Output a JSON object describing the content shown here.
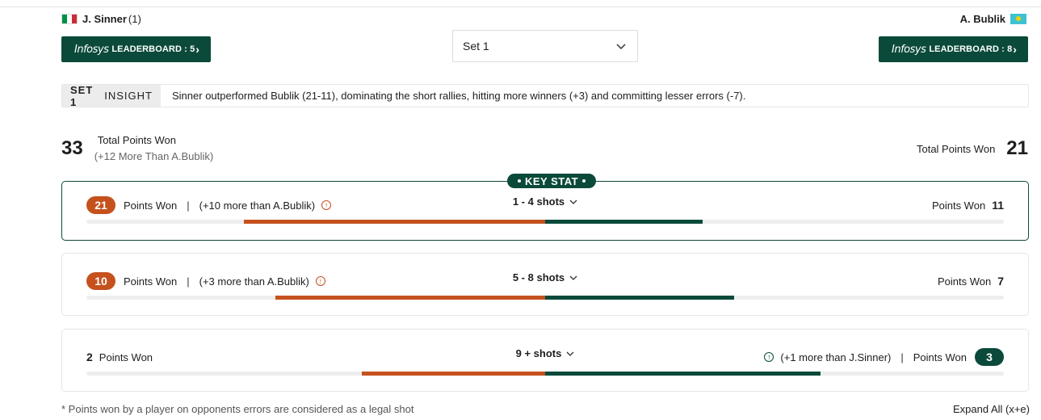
{
  "players": {
    "left": {
      "name": "J. Sinner",
      "seed": "(1)",
      "flag": "italy-flag"
    },
    "right": {
      "name": "A. Bublik",
      "flag": "kazakhstan-flag"
    }
  },
  "leaderboard": {
    "brand": "Infosys",
    "left_label": "LEADERBOARD : 5",
    "right_label": "LEADERBOARD : 8"
  },
  "set_select": {
    "value": "Set 1"
  },
  "insight": {
    "tag_bold": "SET 1",
    "tag": "INSIGHT",
    "text": "Sinner outperformed Bublik (21-11), dominating the short rallies, hitting more winners (+3) and committing lesser errors (-7)."
  },
  "totals": {
    "left_num": "33",
    "left_label": "Total Points Won",
    "left_sub": "(+12 More Than A.Bublik)",
    "right_label": "Total Points Won",
    "right_num": "21"
  },
  "key_stat": "KEY STAT",
  "cards": [
    {
      "left_num": "21",
      "left_label": "Points Won",
      "left_diff": "(+10 more than A.Bublik)",
      "shots": "1 - 4 shots",
      "right_label": "Points Won",
      "right_num": "11",
      "left_fraction": 0.656,
      "right_fraction": 0.344
    },
    {
      "left_num": "10",
      "left_label": "Points Won",
      "left_diff": "(+3 more than A.Bublik)",
      "shots": "5 - 8 shots",
      "right_label": "Points Won",
      "right_num": "7",
      "left_fraction": 0.588,
      "right_fraction": 0.412
    },
    {
      "left_num": "2",
      "left_label": "Points Won",
      "right_diff": "(+1 more than J.Sinner)",
      "shots": "9 + shots",
      "right_label": "Points Won",
      "right_num": "3",
      "left_fraction": 0.4,
      "right_fraction": 0.6
    }
  ],
  "footnote": "* Points won by a player on opponents errors are considered as a legal shot",
  "expand_all": "Expand All (x+e)",
  "colors": {
    "sinner": "#c5511d",
    "bublik": "#0b4a3a"
  }
}
